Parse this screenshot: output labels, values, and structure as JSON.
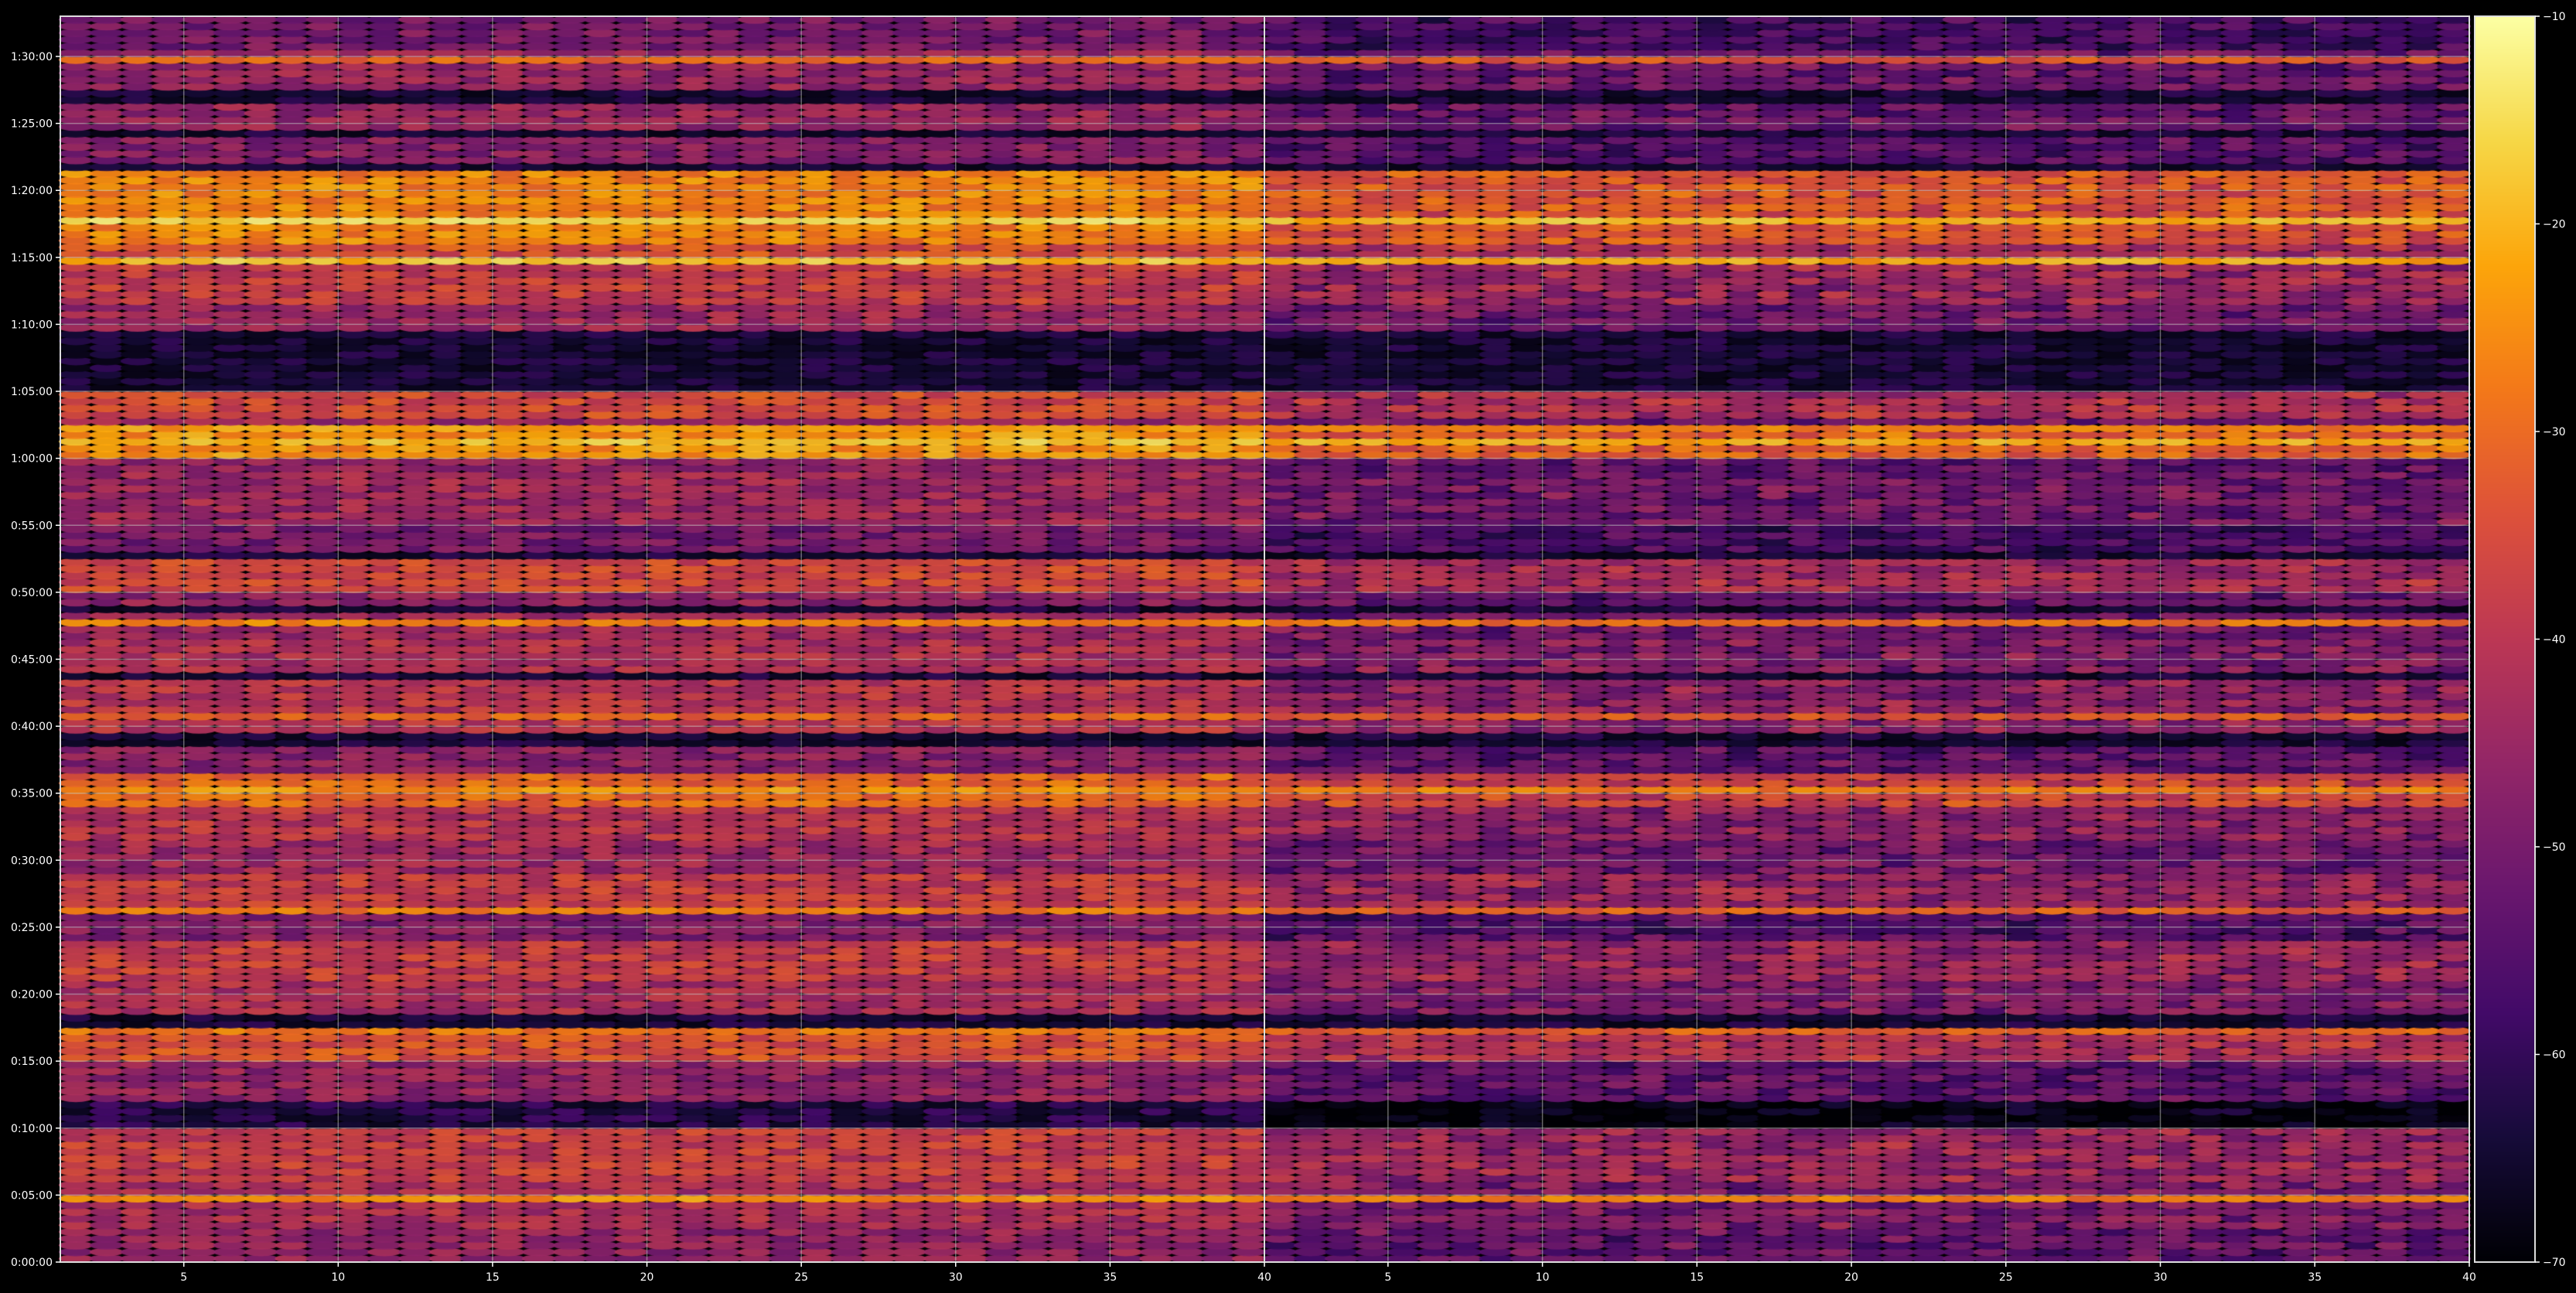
{
  "chart_data": {
    "type": "heatmap",
    "title": "",
    "xlabel": "",
    "ylabel": "",
    "colormap": "inferno",
    "background": "#000000",
    "grid": true,
    "panels": [
      {
        "name": "",
        "xlim": [
          1,
          40
        ],
        "xticks": [
          5,
          10,
          15,
          20,
          25,
          30,
          35,
          40
        ],
        "x_tick_labels": [
          "5",
          "10",
          "15",
          "20",
          "25",
          "30",
          "35",
          "40"
        ]
      },
      {
        "name": "",
        "xlim": [
          1,
          40
        ],
        "xticks": [
          5,
          10,
          15,
          20,
          25,
          30,
          35,
          40
        ],
        "x_tick_labels": [
          "5",
          "10",
          "15",
          "20",
          "25",
          "30",
          "35",
          "40"
        ]
      }
    ],
    "x_columns": [
      1.5,
      2.5,
      3.5,
      4.5,
      5.5,
      6.5,
      7.5,
      8.5,
      9.5,
      10.5,
      11.5,
      12.5,
      13.5,
      14.5,
      15.5,
      16.5,
      17.5,
      18.5,
      19.5,
      20.5,
      21.5,
      22.5,
      23.5,
      24.5,
      25.5,
      26.5,
      27.5,
      28.5,
      29.5,
      30.5,
      31.5,
      32.5,
      33.5,
      34.5,
      35.5,
      36.5,
      37.5,
      38.5,
      39.5
    ],
    "y_unit": "seconds",
    "ylim": [
      0,
      5580
    ],
    "y_ticks": [
      0,
      300,
      600,
      900,
      1200,
      1500,
      1800,
      2100,
      2400,
      2700,
      3000,
      3300,
      3600,
      3900,
      4200,
      4500,
      4800,
      5100,
      5400
    ],
    "y_tick_labels": [
      "0:00:00",
      "0:05:00",
      "0:10:00",
      "0:15:00",
      "0:20:00",
      "0:25:00",
      "0:30:00",
      "0:35:00",
      "0:40:00",
      "0:45:00",
      "0:50:00",
      "0:55:00",
      "1:00:00",
      "1:05:00",
      "1:10:00",
      "1:15:00",
      "1:20:00",
      "1:25:00",
      "1:30:00"
    ],
    "colorbar": {
      "range": [
        -70,
        -10
      ],
      "ticks": [
        -10,
        -20,
        -30,
        -40,
        -50,
        -60,
        -70
      ],
      "tick_labels": [
        "−10",
        "−20",
        "−30",
        "−40",
        "−50",
        "−60",
        "−70"
      ]
    },
    "bands": [
      {
        "t_start": 5400,
        "t_end": 5580,
        "level": -50,
        "note_left_only_stronger": 0
      },
      {
        "t_start": 5250,
        "t_end": 5400,
        "level": -45
      },
      {
        "t_start": 5070,
        "t_end": 5160,
        "level": -45
      },
      {
        "t_start": 4920,
        "t_end": 5010,
        "level": -48
      },
      {
        "t_start": 4560,
        "t_end": 4860,
        "level": -26
      },
      {
        "t_start": 4470,
        "t_end": 4560,
        "level": -34
      },
      {
        "t_start": 4290,
        "t_end": 4470,
        "level": -38
      },
      {
        "t_start": 4170,
        "t_end": 4290,
        "level": -44
      },
      {
        "t_start": 3960,
        "t_end": 4020,
        "level": -66
      },
      {
        "t_start": 3780,
        "t_end": 3870,
        "level": -35
      },
      {
        "t_start": 3720,
        "t_end": 3780,
        "level": -44
      },
      {
        "t_start": 3600,
        "t_end": 3720,
        "level": -24
      },
      {
        "t_start": 3510,
        "t_end": 3600,
        "level": -46
      },
      {
        "t_start": 3300,
        "t_end": 3510,
        "level": -44
      },
      {
        "t_start": 3180,
        "t_end": 3300,
        "level": -50
      },
      {
        "t_start": 3000,
        "t_end": 3120,
        "level": -36
      },
      {
        "t_start": 2940,
        "t_end": 3000,
        "level": -46
      },
      {
        "t_start": 2760,
        "t_end": 2880,
        "level": -44
      },
      {
        "t_start": 2640,
        "t_end": 2760,
        "level": -42
      },
      {
        "t_start": 2370,
        "t_end": 2580,
        "level": -40
      },
      {
        "t_start": 2160,
        "t_end": 2280,
        "level": -47
      },
      {
        "t_start": 2040,
        "t_end": 2160,
        "level": -30
      },
      {
        "t_start": 1890,
        "t_end": 2040,
        "level": -40
      },
      {
        "t_start": 1740,
        "t_end": 1860,
        "level": -44
      },
      {
        "t_start": 1560,
        "t_end": 1710,
        "level": -38
      },
      {
        "t_start": 1440,
        "t_end": 1530,
        "level": -48
      },
      {
        "t_start": 1260,
        "t_end": 1410,
        "level": -38
      },
      {
        "t_start": 1110,
        "t_end": 1260,
        "level": -42
      },
      {
        "t_start": 900,
        "t_end": 1020,
        "level": -34
      },
      {
        "t_start": 720,
        "t_end": 870,
        "level": -46
      },
      {
        "t_start": 600,
        "t_end": 690,
        "level": -62
      },
      {
        "t_start": 360,
        "t_end": 570,
        "level": -38
      },
      {
        "t_start": 150,
        "t_end": 360,
        "level": -42
      },
      {
        "t_start": 0,
        "t_end": 120,
        "level": -46
      }
    ],
    "peaks": [
      {
        "t": 4650,
        "level": -16,
        "note": "1:17:30 strong band both panels"
      },
      {
        "t": 4470,
        "level": -18
      },
      {
        "t": 3660,
        "level": -18
      },
      {
        "t": 3720,
        "level": -24
      },
      {
        "t": 2850,
        "level": -26
      },
      {
        "t": 2100,
        "level": -24
      },
      {
        "t": 2430,
        "level": -30
      },
      {
        "t": 1560,
        "level": -28
      },
      {
        "t": 1020,
        "level": -28
      },
      {
        "t": 270,
        "level": -24
      },
      {
        "t": 5370,
        "level": -30
      }
    ]
  }
}
